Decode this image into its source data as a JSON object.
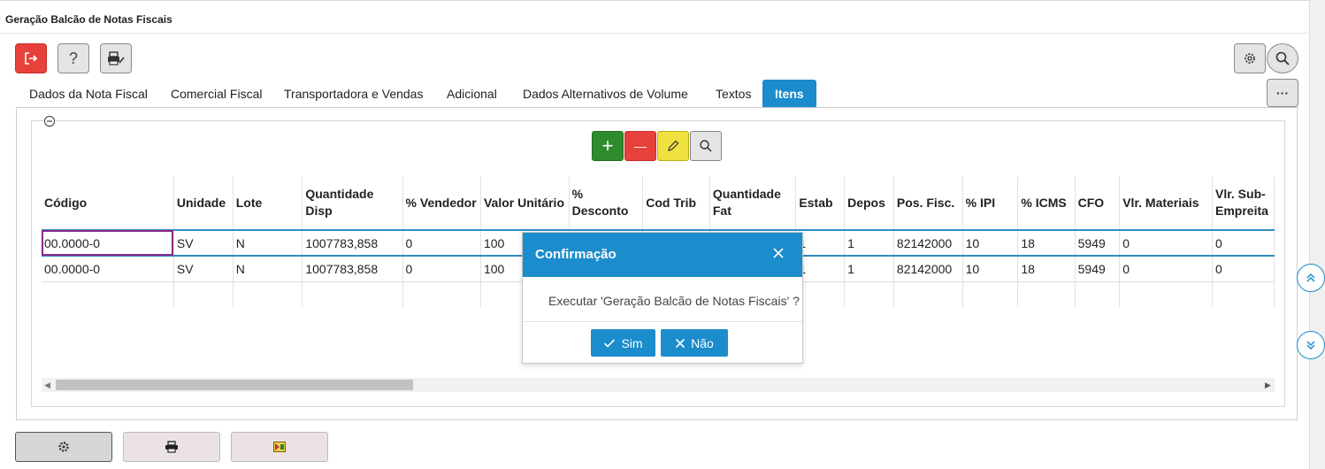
{
  "window": {
    "title": "Geração Balcão de Notas Fiscais"
  },
  "toolbar": {
    "exit_icon": "exit-icon",
    "help_label": "?",
    "print_icon": "printer-edit-icon",
    "settings_icon": "gear-icon",
    "search_icon": "search-icon",
    "more_label": "···"
  },
  "tabs": [
    {
      "label": "Dados da Nota Fiscal"
    },
    {
      "label": "Comercial Fiscal"
    },
    {
      "label": "Transportadora e Vendas"
    },
    {
      "label": "Adicional"
    },
    {
      "label": "Dados Alternativos de Volume"
    },
    {
      "label": "Textos"
    },
    {
      "label": "Itens",
      "active": true
    }
  ],
  "grid_toolbar": {
    "add_label": "+",
    "remove_label": "—",
    "add_color": "#2e8b2e",
    "remove_color": "#e8403a",
    "edit_color": "#f0e040"
  },
  "table": {
    "columns": [
      {
        "label": "Código"
      },
      {
        "label": "Unidade"
      },
      {
        "label": "Lote"
      },
      {
        "label": "Quantidade Disp"
      },
      {
        "label": "% Vendedor"
      },
      {
        "label": "Valor Unitário"
      },
      {
        "label": "% Desconto"
      },
      {
        "label": "Cod Trib"
      },
      {
        "label": "Quantidade Fat"
      },
      {
        "label": "Estab"
      },
      {
        "label": "Depos"
      },
      {
        "label": "Pos. Fisc."
      },
      {
        "label": "% IPI"
      },
      {
        "label": "% ICMS"
      },
      {
        "label": "CFO"
      },
      {
        "label": "Vlr. Materiais"
      },
      {
        "label": "Vlr. Sub-Empreita"
      }
    ],
    "rows": [
      [
        "00.0000-0",
        "SV",
        "N",
        "1007783,858",
        "0",
        "100",
        "",
        "",
        "",
        "1",
        "1",
        "82142000",
        "10",
        "18",
        "5949",
        "0",
        "0"
      ],
      [
        "00.0000-0",
        "SV",
        "N",
        "1007783,858",
        "0",
        "100",
        "",
        "",
        "",
        "1",
        "1",
        "82142000",
        "10",
        "18",
        "5949",
        "0",
        "0"
      ],
      [
        "",
        "",
        "",
        "",
        "",
        "",
        "",
        "",
        "",
        "",
        "",
        "",
        "",
        "",
        "",
        "",
        ""
      ]
    ]
  },
  "dialog": {
    "title": "Confirmação",
    "message": "Executar 'Geração Balcão de Notas Fiscais' ?",
    "yes_label": "Sim",
    "no_label": "Não",
    "accent": "#1b8ccc"
  },
  "side_nav": {
    "up_icon": "double-chevron-up-icon",
    "down_icon": "double-chevron-down-icon"
  },
  "bottom": {
    "config_icon": "gear-icon",
    "print_icon": "printer-icon",
    "export_icon": "export-icon"
  }
}
